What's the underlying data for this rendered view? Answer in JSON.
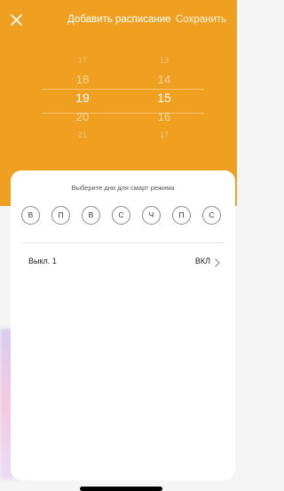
{
  "header": {
    "title": "Добавить расписание",
    "save_label": "Сохранить",
    "accent_color": "#f0a020"
  },
  "picker": {
    "hours": [
      "17",
      "18",
      "19",
      "20",
      "21"
    ],
    "minutes": [
      "13",
      "14",
      "15",
      "16",
      "17"
    ],
    "selected_hour": "19",
    "selected_minute": "15"
  },
  "card": {
    "prompt": "Выберите дни для смарт режима",
    "days": [
      "В",
      "П",
      "В",
      "С",
      "Ч",
      "П",
      "С"
    ],
    "mode_label": "Выкл. 1",
    "mode_state": "ВКЛ"
  },
  "icons": {
    "close": "close-icon",
    "chevron": "chevron-right-icon"
  }
}
